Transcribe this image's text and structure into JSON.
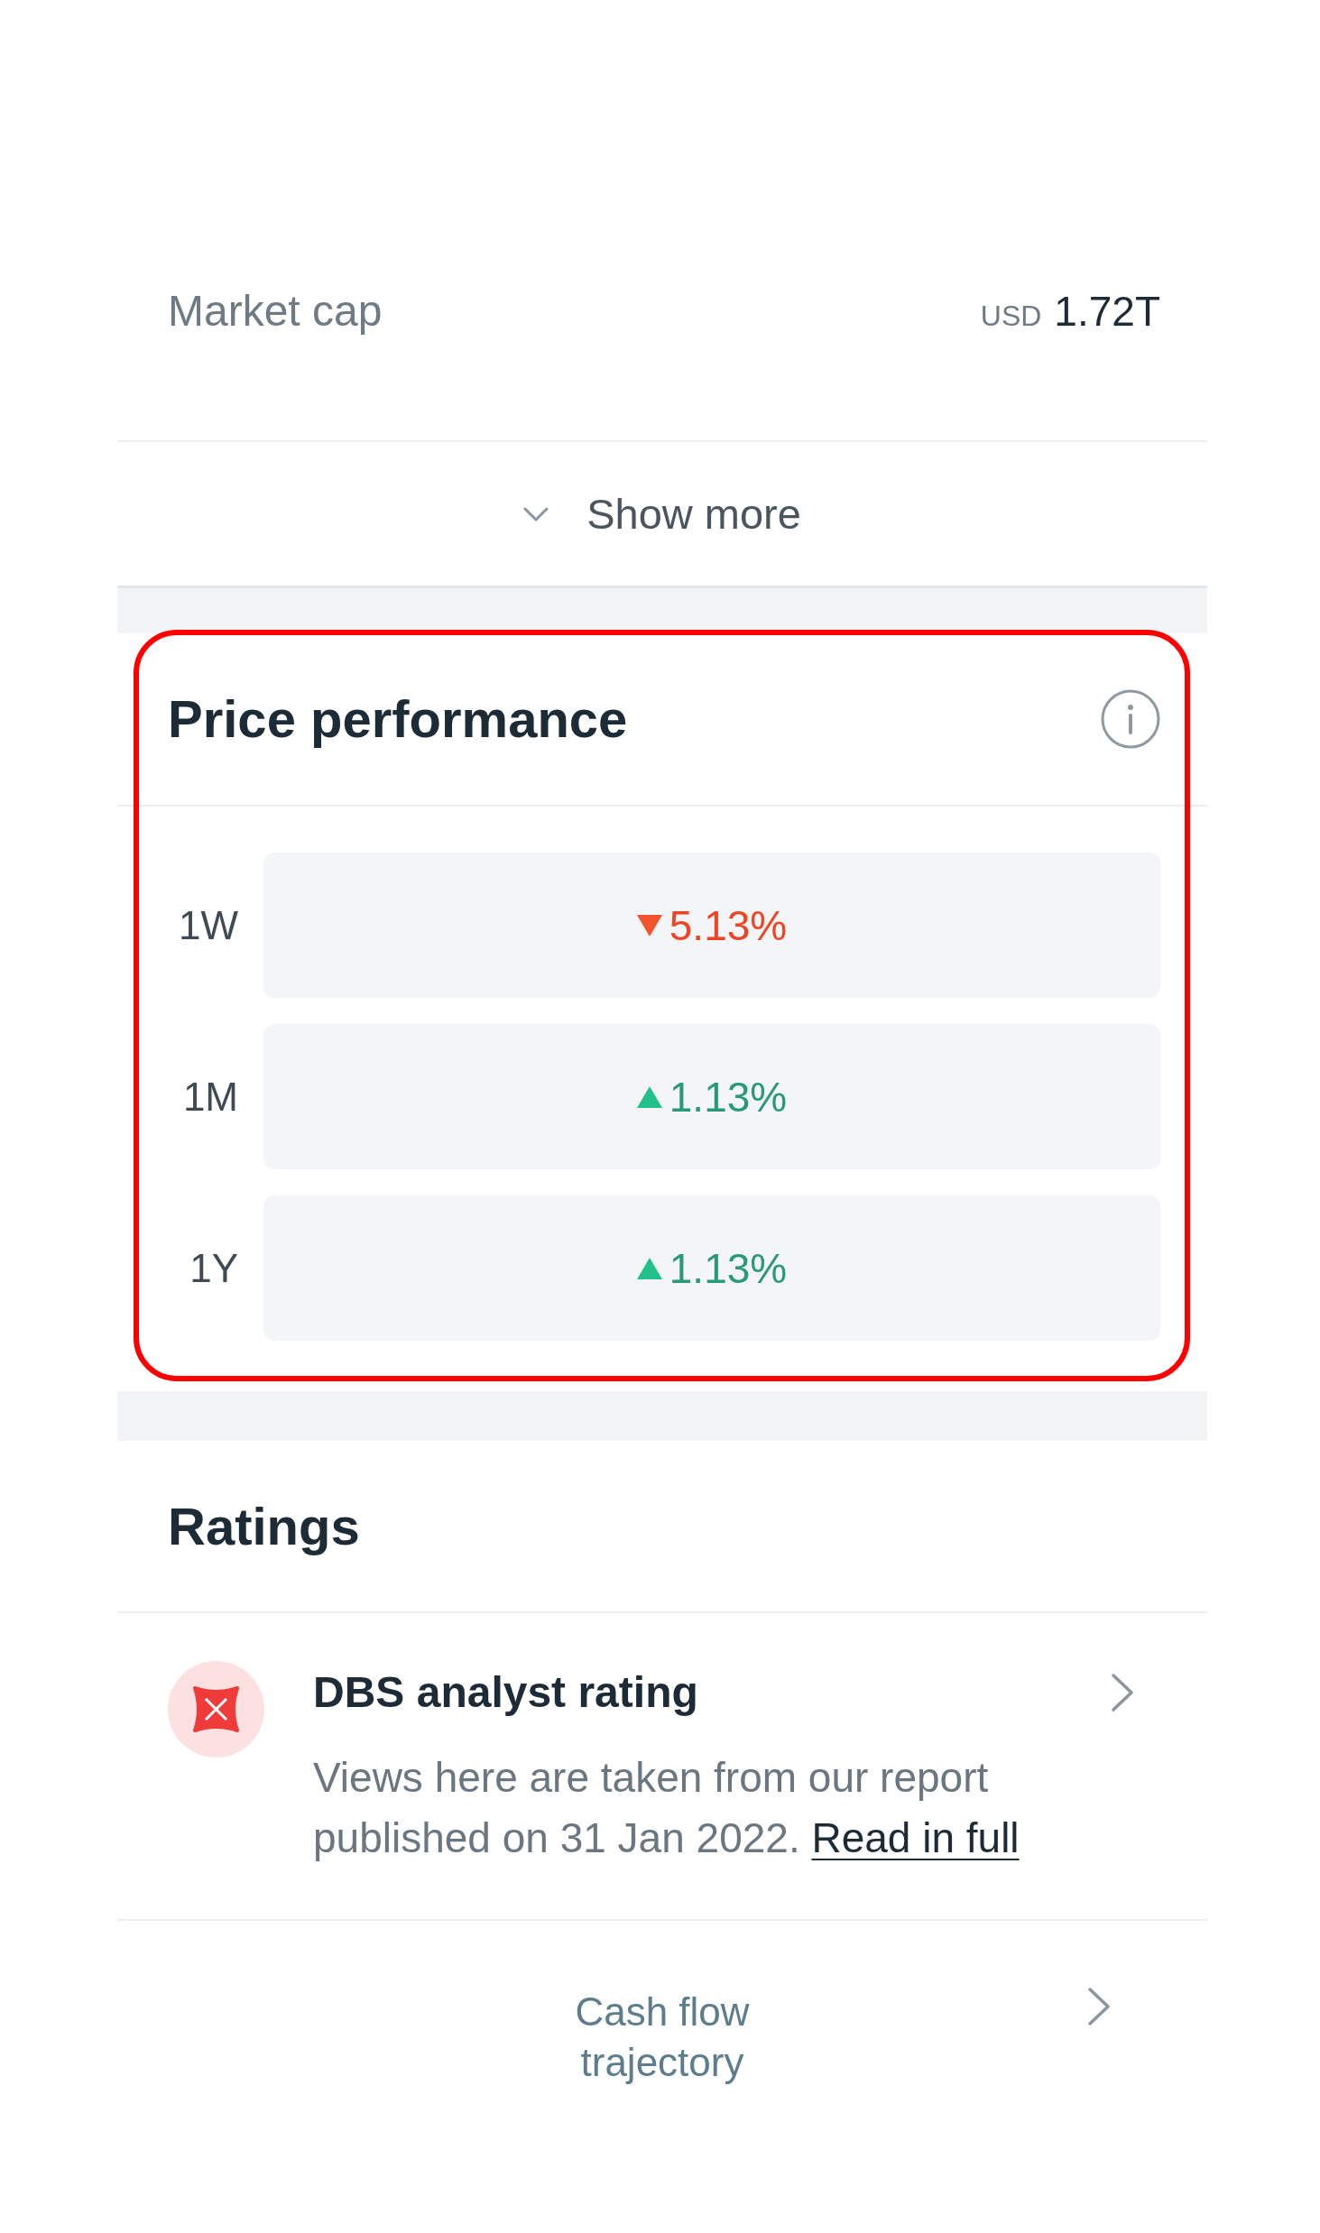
{
  "market_cap": {
    "label": "Market cap",
    "currency": "USD",
    "value": "1.72T"
  },
  "show_more": {
    "label": "Show more",
    "expanded": false
  },
  "price_performance": {
    "title": "Price performance",
    "highlighted": true,
    "rows": [
      {
        "period": "1W",
        "rising": false,
        "change": "5.13%"
      },
      {
        "period": "1M",
        "rising": true,
        "change": "1.13%"
      },
      {
        "period": "1Y",
        "rising": true,
        "change": "1.13%"
      }
    ]
  },
  "ratings": {
    "title": "Ratings",
    "items": [
      {
        "title": "DBS analyst rating",
        "description": "Views here are taken from our report published on 31 Jan 2022.",
        "link": "Read in full"
      }
    ]
  },
  "links": [
    {
      "label": "Cash flow trajectory"
    }
  ]
}
